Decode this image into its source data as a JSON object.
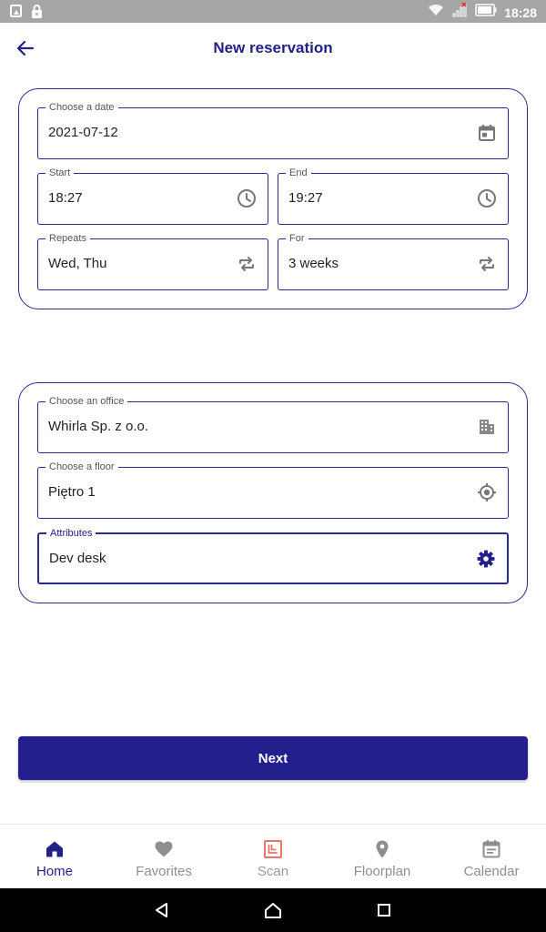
{
  "status_bar": {
    "time": "18:28"
  },
  "header": {
    "title": "New reservation"
  },
  "date_card": {
    "date": {
      "label": "Choose a date",
      "value": "2021-07-12",
      "icon": "calendar-icon"
    },
    "start": {
      "label": "Start",
      "value": "18:27",
      "icon": "clock-icon"
    },
    "end": {
      "label": "End",
      "value": "19:27",
      "icon": "clock-icon"
    },
    "repeats": {
      "label": "Repeats",
      "value": "Wed, Thu",
      "icon": "repeat-icon"
    },
    "for": {
      "label": "For",
      "value": "3 weeks",
      "icon": "repeat-icon"
    }
  },
  "place_card": {
    "office": {
      "label": "Choose an office",
      "value": "Whirla Sp. z o.o.",
      "icon": "building-icon"
    },
    "floor": {
      "label": "Choose a floor",
      "value": "Piętro 1",
      "icon": "location-target-icon"
    },
    "attributes": {
      "label": "Attributes",
      "value": "Dev desk",
      "icon": "gear-icon"
    }
  },
  "next_button": {
    "label": "Next"
  },
  "bottom_nav": {
    "items": [
      {
        "label": "Home",
        "icon": "home-icon",
        "active": true
      },
      {
        "label": "Favorites",
        "icon": "heart-icon",
        "active": false
      },
      {
        "label": "Scan",
        "icon": "scan-icon",
        "active": false
      },
      {
        "label": "Floorplan",
        "icon": "map-pin-icon",
        "active": false
      },
      {
        "label": "Calendar",
        "icon": "calendar-icon",
        "active": false
      }
    ]
  },
  "colors": {
    "primary": "#231f8c",
    "inactive": "#8e8e8e",
    "scan_accent": "#e5776f",
    "status_bar": "#a6a6a6"
  }
}
